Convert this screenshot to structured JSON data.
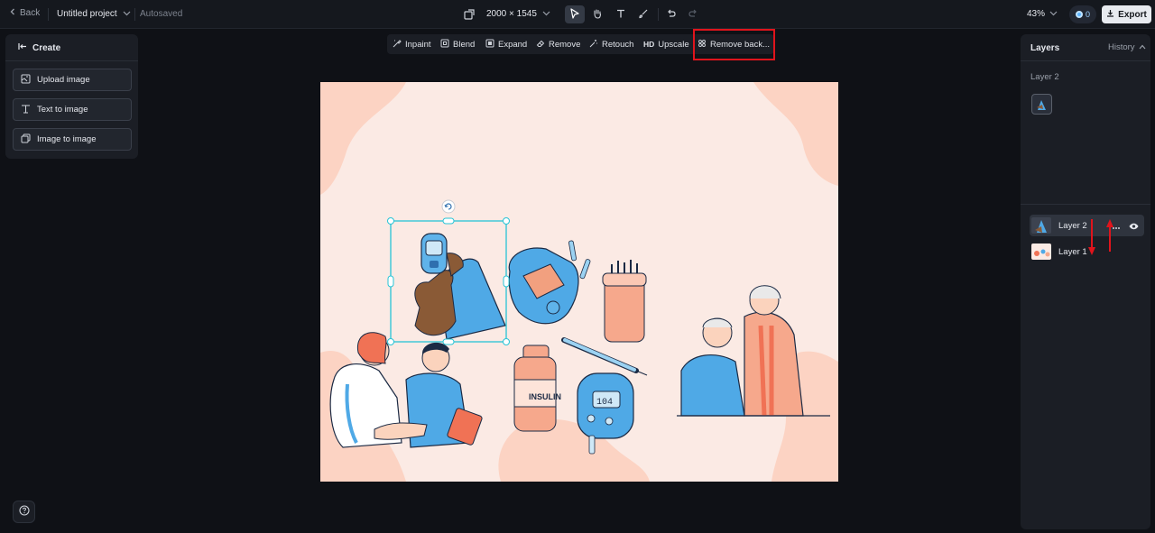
{
  "topbar": {
    "back_label": "Back",
    "project_name": "Untitled project",
    "save_status": "Autosaved",
    "canvas_size": "2000 × 1545",
    "zoom": "43%",
    "credits": "0",
    "export_label": "Export",
    "tools": [
      "pointer-icon",
      "hand-icon",
      "text-icon",
      "brush-icon",
      "undo-icon",
      "redo-icon"
    ]
  },
  "left_panel": {
    "title": "Create",
    "buttons": [
      {
        "label": "Upload image",
        "icon": "upload-image-icon"
      },
      {
        "label": "Text to image",
        "icon": "text-to-image-icon"
      },
      {
        "label": "Image to image",
        "icon": "image-to-image-icon"
      }
    ]
  },
  "context_toolbar": {
    "items": [
      {
        "label": "Inpaint",
        "icon": "inpaint-icon"
      },
      {
        "label": "Blend",
        "icon": "blend-icon"
      },
      {
        "label": "Expand",
        "icon": "expand-icon"
      },
      {
        "label": "Remove",
        "icon": "eraser-icon"
      },
      {
        "label": "Retouch",
        "icon": "retouch-icon"
      },
      {
        "label": "Upscale",
        "badge": "HD",
        "icon": "hd-icon"
      },
      {
        "label": "Remove back...",
        "icon": "remove-background-icon",
        "highlighted": true
      }
    ]
  },
  "canvas": {
    "insulin_label": "INSULIN",
    "meter_reading": "104"
  },
  "right_panel": {
    "title": "Layers",
    "history_label": "History",
    "selected_layer_label": "Layer 2",
    "layers": [
      {
        "name": "Layer 2",
        "selected": true
      },
      {
        "name": "Layer 1",
        "selected": false
      }
    ]
  },
  "colors": {
    "highlight": "#e0141c",
    "canvas_bg": "#fbeae4",
    "selection": "#27c4d6"
  }
}
